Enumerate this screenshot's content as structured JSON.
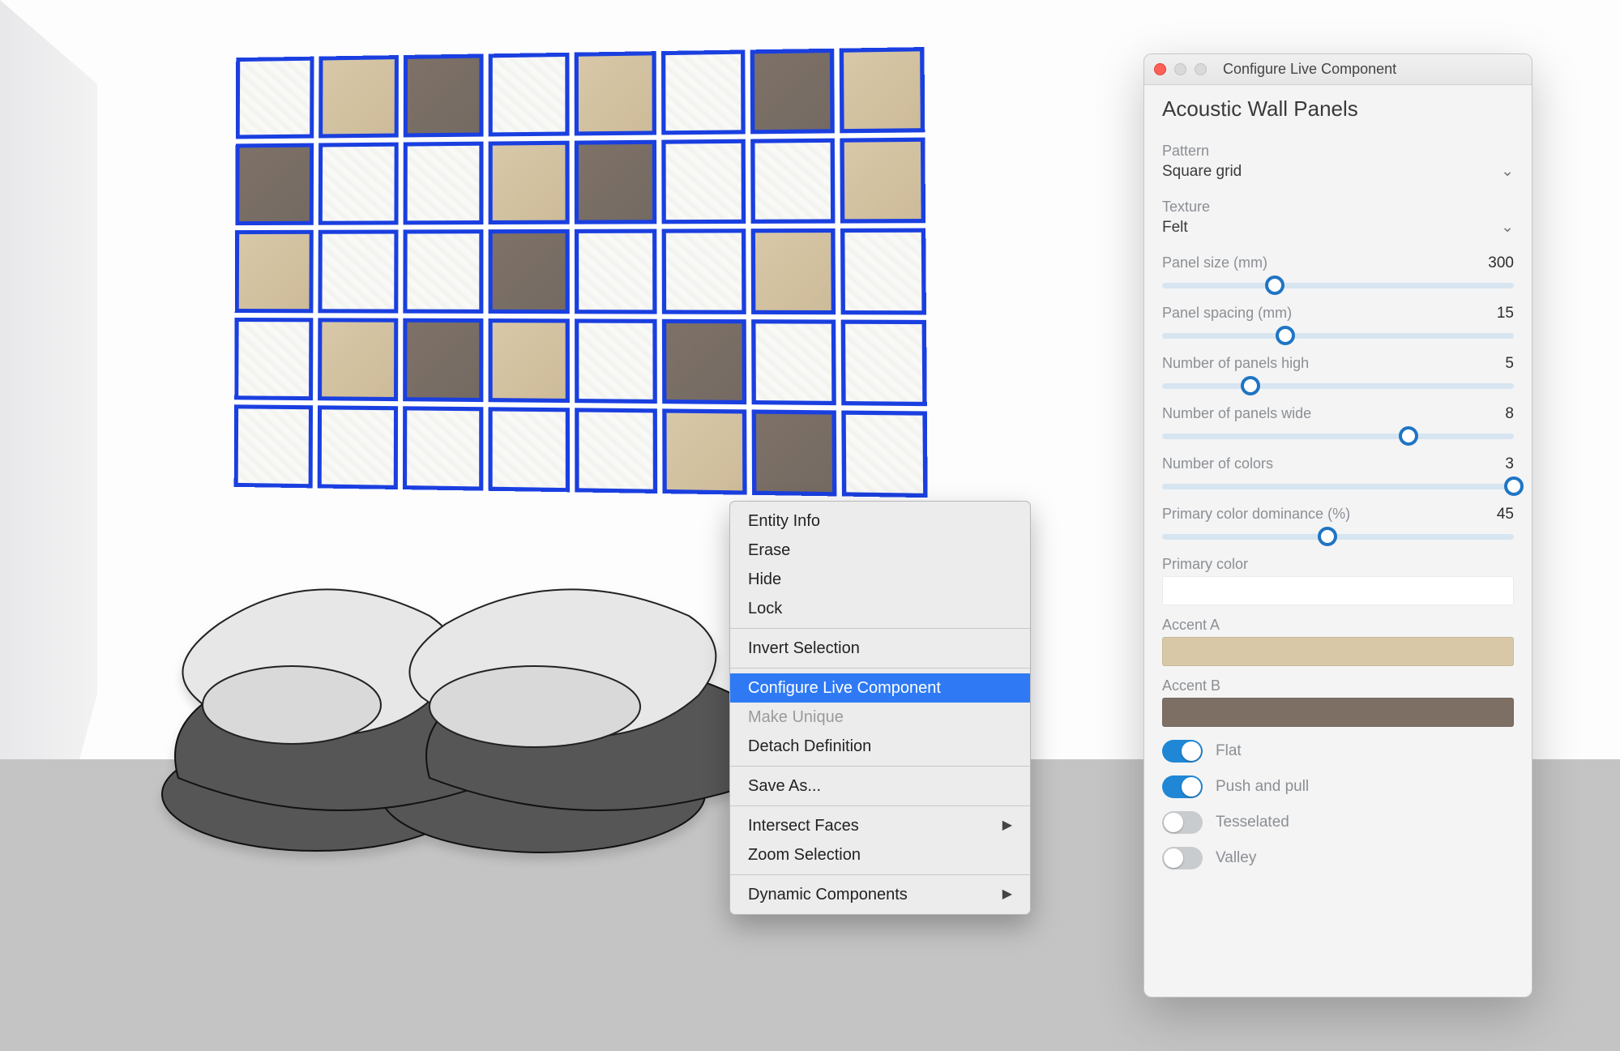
{
  "window_title": "Configure Live Component",
  "panel_heading": "Acoustic Wall Panels",
  "context_menu": {
    "groups": [
      [
        "Entity Info",
        "Erase",
        "Hide",
        "Lock"
      ],
      [
        "Invert Selection"
      ],
      [
        "Configure Live Component",
        "Make Unique",
        "Detach Definition"
      ],
      [
        "Save As..."
      ],
      [
        "Intersect Faces",
        "Zoom Selection"
      ],
      [
        "Dynamic Components"
      ]
    ],
    "highlighted": "Configure Live Component",
    "disabled": [
      "Make Unique"
    ],
    "submenu": [
      "Intersect Faces",
      "Dynamic Components"
    ]
  },
  "selects": {
    "pattern": {
      "label": "Pattern",
      "value": "Square grid"
    },
    "texture": {
      "label": "Texture",
      "value": "Felt"
    }
  },
  "sliders": {
    "panel_size": {
      "label": "Panel size (mm)",
      "value": 300,
      "min": 50,
      "max": 900,
      "pct": 32
    },
    "spacing": {
      "label": "Panel spacing (mm)",
      "value": 15,
      "min": 0,
      "max": 50,
      "pct": 35
    },
    "high": {
      "label": "Number of panels high",
      "value": 5,
      "min": 1,
      "max": 20,
      "pct": 25
    },
    "wide": {
      "label": "Number of panels wide",
      "value": 8,
      "min": 1,
      "max": 12,
      "pct": 70
    },
    "colors": {
      "label": "Number of colors",
      "value": 3,
      "min": 1,
      "max": 3,
      "pct": 100
    },
    "dominance": {
      "label": "Primary color dominance (%)",
      "value": 45,
      "min": 0,
      "max": 100,
      "pct": 47
    }
  },
  "color_fields": {
    "primary": {
      "label": "Primary color",
      "swatch": "white"
    },
    "accent_a": {
      "label": "Accent A",
      "swatch": "tan",
      "hex": "#d8c8a8"
    },
    "accent_b": {
      "label": "Accent B",
      "swatch": "brown",
      "hex": "#7e6f65"
    }
  },
  "toggles": {
    "flat": {
      "label": "Flat",
      "on": true
    },
    "push_pull": {
      "label": "Push and pull",
      "on": true
    },
    "tesselated": {
      "label": "Tesselated",
      "on": false
    },
    "valley": {
      "label": "Valley",
      "on": false
    }
  },
  "panel_grid": {
    "rows": 5,
    "cols": 8,
    "cells": [
      [
        0,
        1,
        2,
        0,
        1,
        0,
        2,
        1
      ],
      [
        2,
        0,
        0,
        1,
        2,
        0,
        0,
        1
      ],
      [
        1,
        0,
        0,
        2,
        0,
        0,
        1,
        0
      ],
      [
        0,
        1,
        2,
        1,
        0,
        2,
        0,
        0
      ],
      [
        0,
        0,
        0,
        0,
        0,
        1,
        2,
        0
      ]
    ]
  },
  "colors": {
    "selection": "#1a3fe0",
    "accent": "#1f87d6"
  }
}
